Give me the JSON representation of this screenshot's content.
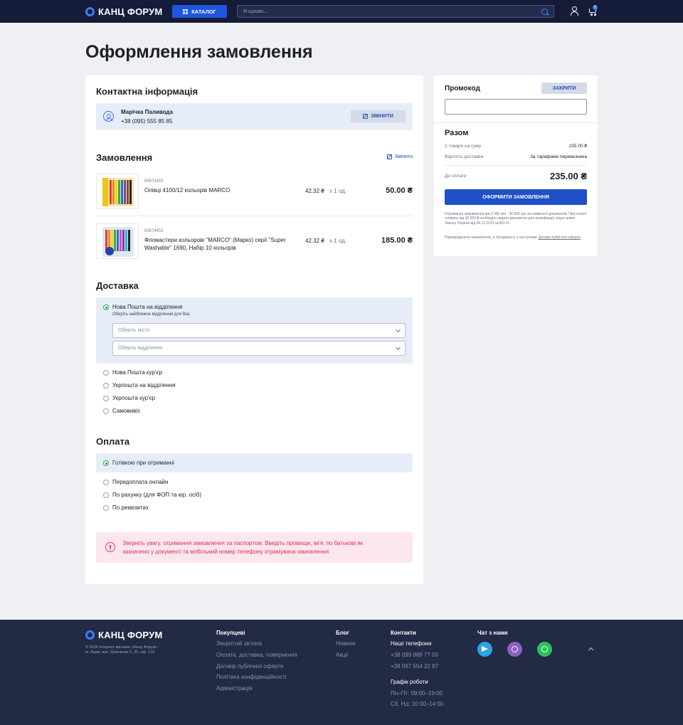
{
  "header": {
    "logo": "КАНЦ ФОРУМ",
    "catalog_label": "КАТАЛОГ",
    "search_placeholder": "Я шукаю...",
    "cart_count": "1"
  },
  "page_title": "Оформлення замовлення",
  "contact": {
    "title": "Контактна інформація",
    "name": "Марічка Паливода",
    "phone": "+38 (095) 555 85 85",
    "change_label": "ЗМІНИТИ"
  },
  "order": {
    "title": "Замовлення",
    "edit_label": "Змінити",
    "items": [
      {
        "sku": "69874455",
        "name": "Олівці 4100/12 кольорів MARCO",
        "price": "42.32 ₴",
        "qty": "x 1 од.",
        "total": "50.00 ₴"
      },
      {
        "sku": "69874455",
        "name": "Фломастери кольорові \"MARCO\" (Марко) серії \"Super Washable\" 1690, Набір 10 кольорів",
        "price": "42.32 ₴",
        "qty": "x 1 од.",
        "total": "185.00 ₴"
      }
    ]
  },
  "delivery": {
    "title": "Доставка",
    "selected": {
      "label": "Нова Пошта на відділення",
      "hint": "Оберіть найближче відділення для Вас",
      "city_placeholder": "Оберіть місто",
      "branch_placeholder": "Оберіть відділення"
    },
    "options": [
      "Нова Пошта кур'єр",
      "Укрпошта на відділення",
      "Укрпошта кур'єр",
      "Самовивіз"
    ]
  },
  "payment": {
    "title": "Оплата",
    "selected": "Готівкою при отриманні",
    "options": [
      "Передоплата онлайн",
      "По рахунку (для ФОП та юр. осіб)",
      "По реквізитах"
    ]
  },
  "alert": {
    "text": "Зверніть увагу, отримання замовлення за паспортом. Введіть прізвище, ім'я, по батькові як зазначено у документі та мобільний номер телефону отримувача замовлення"
  },
  "summary": {
    "promo_title": "Промокод",
    "promo_close": "ЗАКРИТИ",
    "title": "Разом",
    "items_label": "2 товари на суму",
    "items_value": "235.00 ₴",
    "delivery_label": "Вартість доставки",
    "delivery_value": "За тарифами перевезника",
    "pay_label": "До сплати",
    "pay_total": "235.00 ₴",
    "checkout_label": "ОФОРМИТИ ЗАМОВЛЕННЯ",
    "note1": "Отримання замовлення від 5 000 грн - 30 000 грн за наявності документів. При оплаті готівкою від 30 000 ₴ необхідно надати документи для верифікації згідно вимог Закону України від 06.12.2019 №361-IX",
    "note2_prefix": "Підтверджуючи замовлення, я погоджуюсь з наступним: ",
    "note2_link": "Договір публічної оферти"
  },
  "footer": {
    "logo": "КАНЦ ФОРУМ",
    "copyright": "© 2024 Інтернет-магазин «Канц Форум»",
    "address": "м. Львів, вул. Шевченка 5, 25, оф. 123",
    "buyers_title": "Покупцеві",
    "buyers_links": [
      "Зворотній зв'язок",
      "Оплата, доставка, повернення",
      "Договір публічної оферти",
      "Політика конфіденційності",
      "Адміністрація"
    ],
    "blog_title": "Блог",
    "blog_links": [
      "Новини",
      "Акції"
    ],
    "contacts_title": "Контакти",
    "phones_title": "Наші телефони",
    "phones": [
      "+38 099 888 77 00",
      "+38 067 654 32 87"
    ],
    "schedule_title": "Графік роботи",
    "schedule": [
      "Пн–Пт: 09:00–19:00",
      "Сб, Нд: 10:00–14:00"
    ],
    "chat_title": "Чат з нами"
  }
}
